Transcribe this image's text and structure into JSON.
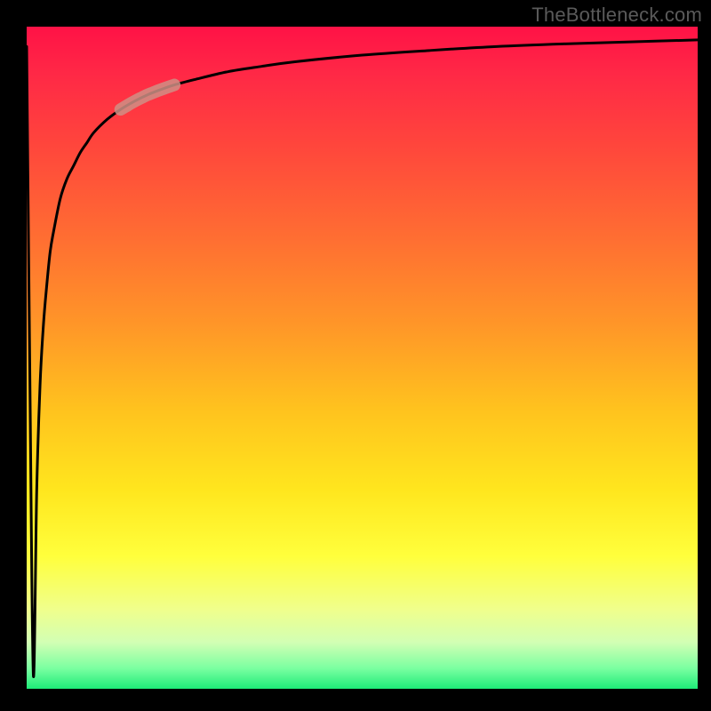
{
  "watermark": "TheBottleneck.com",
  "chart_data": {
    "type": "line",
    "title": "",
    "xlabel": "",
    "ylabel": "",
    "xlim": [
      0,
      100
    ],
    "ylim": [
      0,
      100
    ],
    "grid": false,
    "legend_position": "none",
    "annotations": [
      {
        "type": "highlight-segment",
        "x_start": 14,
        "x_end": 22,
        "color": "#cf8f85"
      }
    ],
    "series": [
      {
        "name": "curve",
        "color": "#000000",
        "x": [
          0,
          0.5,
          1,
          1.5,
          2,
          2.5,
          3,
          3.5,
          4,
          5,
          6,
          7,
          8,
          9,
          10,
          12,
          14,
          16,
          18,
          20,
          22,
          25,
          30,
          35,
          40,
          50,
          60,
          70,
          80,
          90,
          100
        ],
        "values": [
          97,
          45,
          2,
          30,
          46,
          55,
          61,
          66,
          69,
          74,
          77,
          79,
          81,
          82.5,
          84,
          86,
          87.5,
          88.7,
          89.7,
          90.5,
          91.2,
          92,
          93.2,
          94,
          94.7,
          95.7,
          96.4,
          97,
          97.4,
          97.7,
          98
        ]
      }
    ]
  }
}
